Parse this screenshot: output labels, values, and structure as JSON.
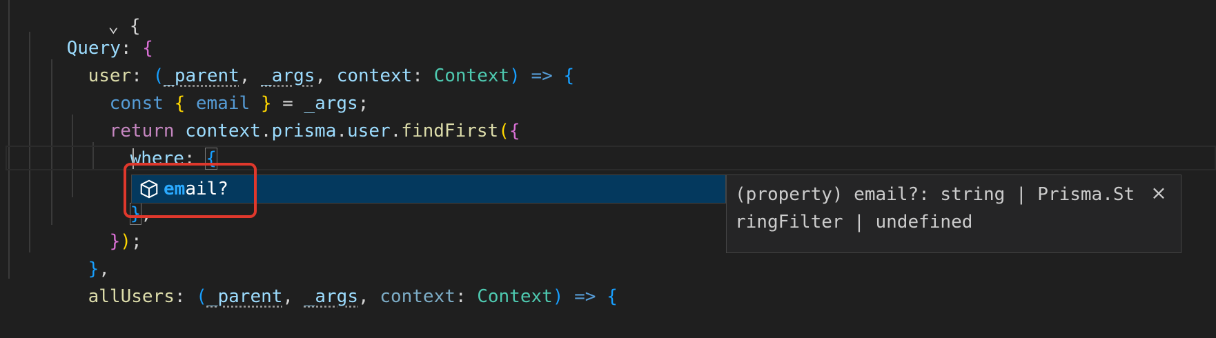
{
  "code": {
    "line0": {
      "text": "      ⌄ {"
    },
    "line1": {
      "key": "Query",
      "colon": ":",
      "brace": "{"
    },
    "line2": {
      "key": "user",
      "colon": ": ",
      "open_paren": "(",
      "p1": "_parent",
      "comma1": ", ",
      "p2": "_args",
      "comma2": ", ",
      "p3": "context",
      "colon2": ": ",
      "type": "Context",
      "close_paren": ")",
      "arrow": " => ",
      "brace": "{"
    },
    "line3": {
      "kw": "const",
      "open": "{",
      "name": "email",
      "close": "}",
      "eq": " = ",
      "rhs": "_args",
      "semi": ";"
    },
    "line4": {
      "kw": "return",
      "obj": "context",
      "dot1": ".",
      "p1": "prisma",
      "dot2": ".",
      "p2": "user",
      "dot3": ".",
      "fn": "findFirst",
      "paren": "(",
      "brace": "{"
    },
    "line5": {
      "key": "where",
      "colon": ": ",
      "brace": "{"
    },
    "line6": {
      "typed": "em"
    },
    "line7": {
      "brace": "}",
      "comma": ","
    },
    "line8": {
      "brace": "}",
      "paren": ")",
      "semi": ";"
    },
    "line9": {
      "brace": "}",
      "comma": ","
    },
    "line10": {
      "key": "allUsers",
      "colon": ": ",
      "open_paren": "(",
      "p1": "_parent",
      "comma1": ", ",
      "p2": "_args",
      "comma2": ", ",
      "p3": "context",
      "colon2": ": ",
      "type": "Context",
      "close_paren": ")",
      "arrow": " => ",
      "brace": "{"
    }
  },
  "suggest": {
    "icon": "cube-property-icon",
    "label_match": "em",
    "label_rest": "ail?"
  },
  "details": {
    "text": "(property) email?: string | Prisma.StringFilter | undefined",
    "close_glyph": "×"
  },
  "colors": {
    "editor_bg": "#1f1f1f",
    "suggest_selected_bg": "#04395e",
    "annotation_red": "#e0382c"
  }
}
